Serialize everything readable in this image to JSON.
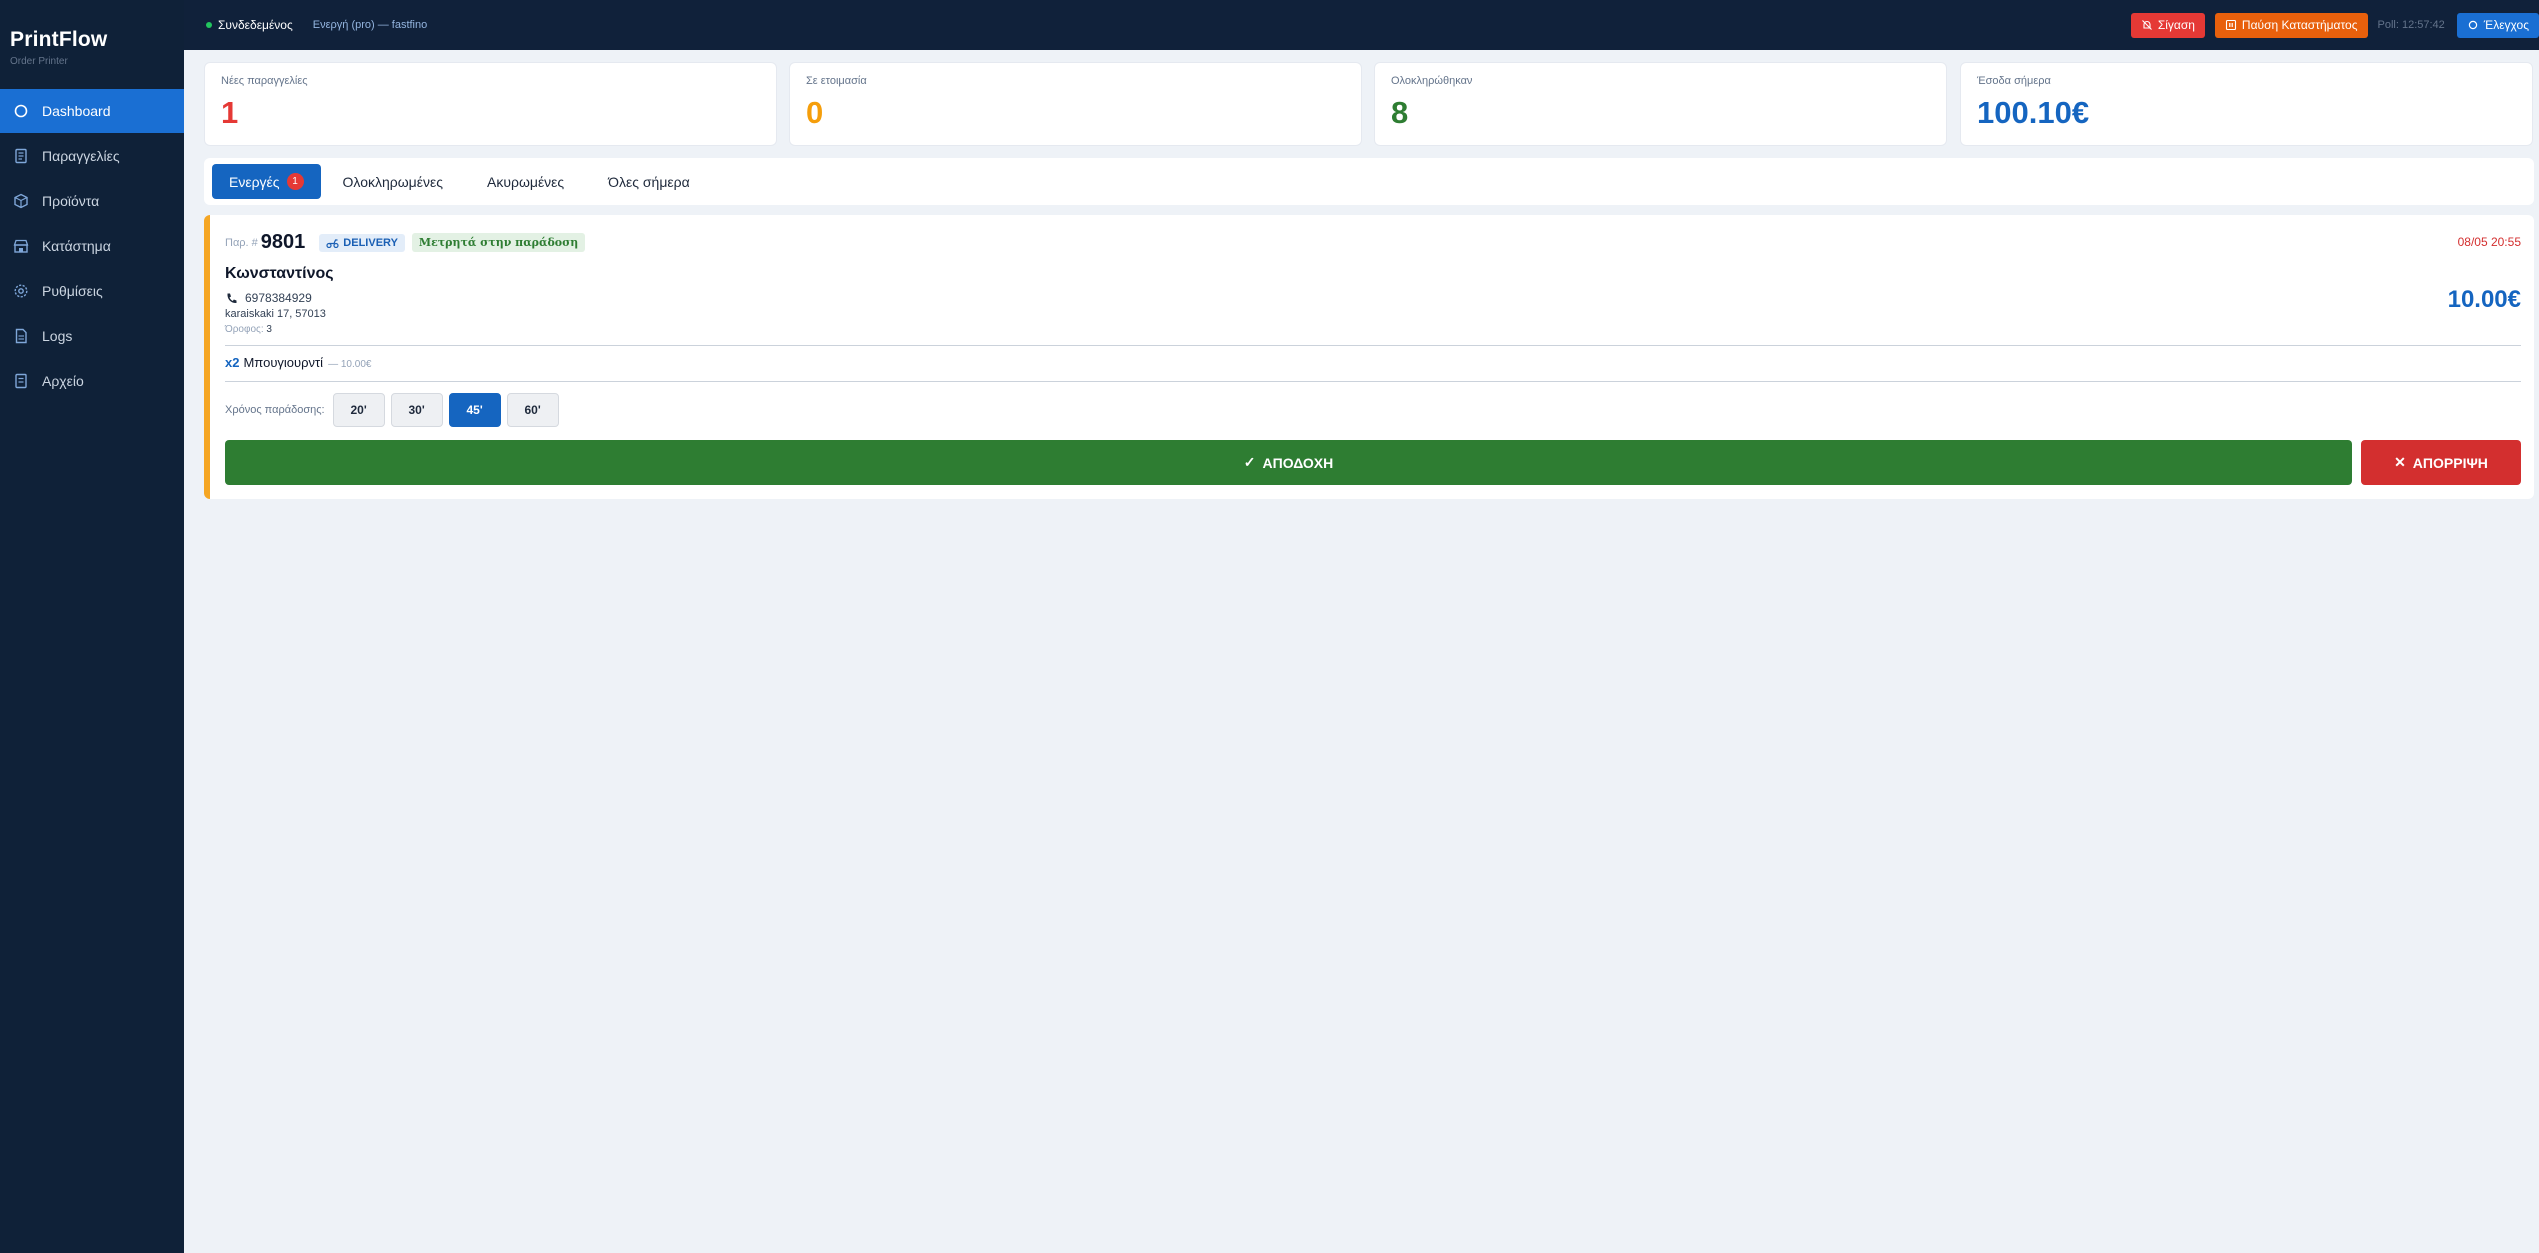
{
  "brand": {
    "title": "PrintFlow",
    "subtitle": "Order Printer"
  },
  "sidebar": {
    "items": [
      {
        "label": "Dashboard",
        "icon": "circle-icon",
        "active": true
      },
      {
        "label": "Παραγγελίες",
        "icon": "receipt-icon"
      },
      {
        "label": "Προϊόντα",
        "icon": "box-icon"
      },
      {
        "label": "Κατάστημα",
        "icon": "store-icon"
      },
      {
        "label": "Ρυθμίσεις",
        "icon": "gear-icon"
      },
      {
        "label": "Logs",
        "icon": "file-icon"
      },
      {
        "label": "Αρχείο",
        "icon": "archive-icon"
      }
    ]
  },
  "topbar": {
    "status": "Συνδεδεμένος",
    "status_color": "#22c55e",
    "license": "Ενεργή (pro) — fastfino",
    "mute_label": "Σίγαση",
    "pause_label": "Παύση Καταστήματος",
    "poll": "Poll: 12:57:42",
    "check_label": "Έλεγχος"
  },
  "stats": [
    {
      "label": "Νέες παραγγελίες",
      "value": "1",
      "color": "#e53935"
    },
    {
      "label": "Σε ετοιμασία",
      "value": "0",
      "color": "#f59e0b"
    },
    {
      "label": "Ολοκληρώθηκαν",
      "value": "8",
      "color": "#2e7d32"
    },
    {
      "label": "Έσοδα σήμερα",
      "value": "100.10€",
      "color": "#1565c0"
    }
  ],
  "tabs": [
    {
      "label": "Ενεργές",
      "badge": "1",
      "active": true
    },
    {
      "label": "Ολοκληρωμένες"
    },
    {
      "label": "Ακυρωμένες"
    },
    {
      "label": "Όλες σήμερα"
    }
  ],
  "order": {
    "prefix": "Παρ. #",
    "number": "9801",
    "delivery_badge": "DELIVERY",
    "payment_badge": "Μετρητά στην παράδοση",
    "datetime": "08/05 20:55",
    "customer": "Κωνσταντίνος",
    "phone": "6978384929",
    "address": "karaiskaki 17, 57013",
    "floor_label": "Όροφος:",
    "floor_value": "3",
    "total": "10.00€",
    "items": [
      {
        "qty": "x2",
        "name": "Μπουγιουρντί",
        "price": "— 10.00€"
      }
    ],
    "eta_label": "Χρόνος παράδοσης:",
    "eta_options": [
      "20'",
      "30'",
      "45'",
      "60'"
    ],
    "eta_selected": "45'",
    "accept_label": "ΑΠΟΔΟΧΗ",
    "reject_label": "ΑΠΟΡΡΙΨΗ"
  }
}
